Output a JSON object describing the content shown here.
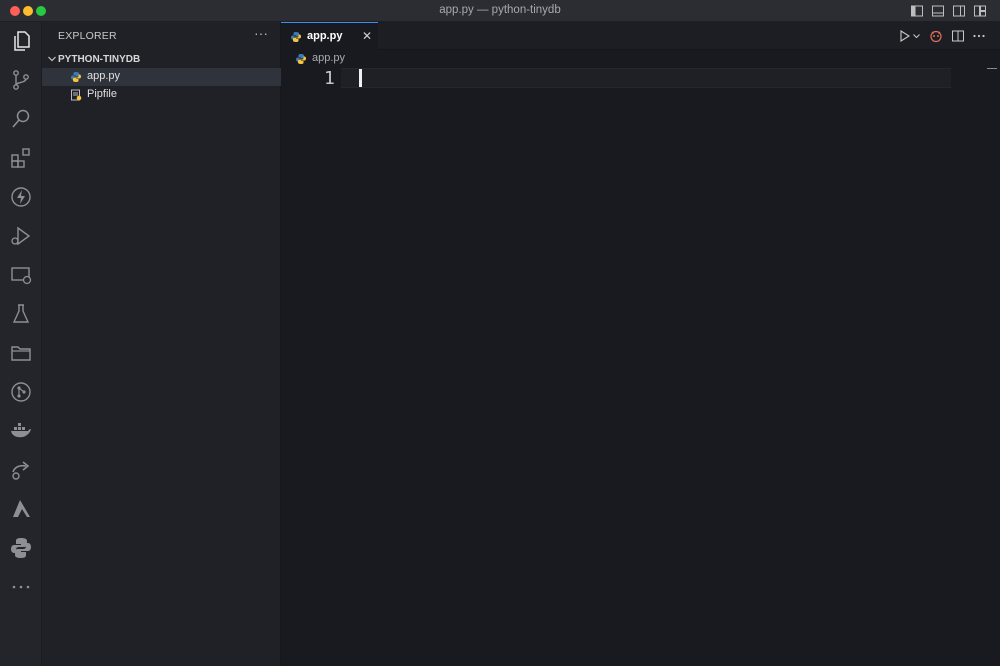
{
  "window": {
    "title": "app.py — python-tinydb"
  },
  "traffic_colors": {
    "close": "#ff5f57",
    "minimize": "#febc2e",
    "zoom": "#28c840"
  },
  "accent": "#3b8eea",
  "activity_bar": {
    "items": [
      {
        "name": "explorer-icon"
      },
      {
        "name": "source-control-icon"
      },
      {
        "name": "search-icon"
      },
      {
        "name": "extensions-icon"
      },
      {
        "name": "lightning-icon"
      },
      {
        "name": "run-debug-icon"
      },
      {
        "name": "remote-explorer-icon"
      },
      {
        "name": "testing-icon"
      },
      {
        "name": "folder-icon"
      },
      {
        "name": "git-graph-icon"
      },
      {
        "name": "docker-icon"
      },
      {
        "name": "live-share-icon"
      },
      {
        "name": "azure-icon"
      },
      {
        "name": "python-icon"
      },
      {
        "name": "more-icon"
      }
    ]
  },
  "sidebar": {
    "title": "EXPLORER",
    "more": "···",
    "folder": "PYTHON-TINYDB",
    "files": [
      {
        "name": "app.py",
        "icon": "python-file-icon",
        "selected": true
      },
      {
        "name": "Pipfile",
        "icon": "pipfile-icon",
        "selected": false
      }
    ]
  },
  "tabs": [
    {
      "label": "app.py",
      "close": "✕"
    }
  ],
  "breadcrumb": {
    "file": "app.py"
  },
  "editor": {
    "lines": [
      {
        "number": "1",
        "text": ""
      }
    ]
  }
}
